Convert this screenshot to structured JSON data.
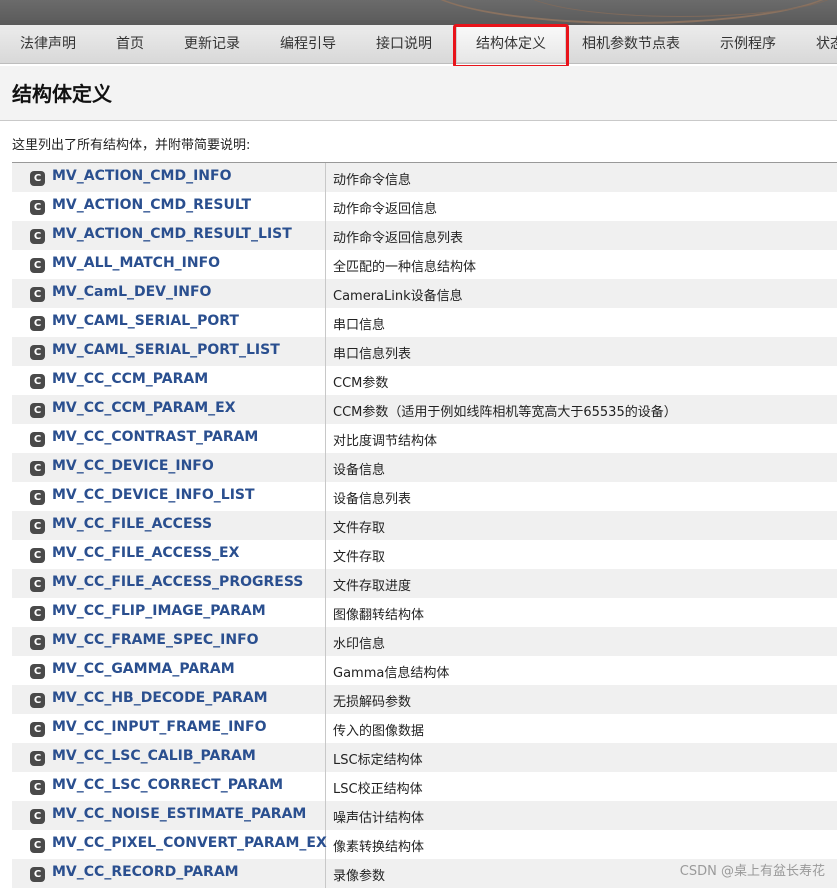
{
  "nav": {
    "tabs": [
      {
        "label": "法律声明",
        "active": false
      },
      {
        "label": "首页",
        "active": false
      },
      {
        "label": "更新记录",
        "active": false
      },
      {
        "label": "编程引导",
        "active": false
      },
      {
        "label": "接口说明",
        "active": false
      },
      {
        "label": "结构体定义",
        "active": true
      },
      {
        "label": "相机参数节点表",
        "active": false
      },
      {
        "label": "示例程序",
        "active": false
      },
      {
        "label": "状态",
        "active": false
      }
    ]
  },
  "page": {
    "title": "结构体定义",
    "intro": "这里列出了所有结构体，并附带简要说明:"
  },
  "structs": [
    {
      "badge": "C",
      "name": "MV_ACTION_CMD_INFO",
      "desc": "动作命令信息"
    },
    {
      "badge": "C",
      "name": "MV_ACTION_CMD_RESULT",
      "desc": "动作命令返回信息"
    },
    {
      "badge": "C",
      "name": "MV_ACTION_CMD_RESULT_LIST",
      "desc": "动作命令返回信息列表"
    },
    {
      "badge": "C",
      "name": "MV_ALL_MATCH_INFO",
      "desc": "全匹配的一种信息结构体"
    },
    {
      "badge": "C",
      "name": "MV_CamL_DEV_INFO",
      "desc": "CameraLink设备信息"
    },
    {
      "badge": "C",
      "name": "MV_CAML_SERIAL_PORT",
      "desc": "串口信息"
    },
    {
      "badge": "C",
      "name": "MV_CAML_SERIAL_PORT_LIST",
      "desc": "串口信息列表"
    },
    {
      "badge": "C",
      "name": "MV_CC_CCM_PARAM",
      "desc": "CCM参数"
    },
    {
      "badge": "C",
      "name": "MV_CC_CCM_PARAM_EX",
      "desc": "CCM参数（适用于例如线阵相机等宽高大于65535的设备）"
    },
    {
      "badge": "C",
      "name": "MV_CC_CONTRAST_PARAM",
      "desc": "对比度调节结构体"
    },
    {
      "badge": "C",
      "name": "MV_CC_DEVICE_INFO",
      "desc": "设备信息"
    },
    {
      "badge": "C",
      "name": "MV_CC_DEVICE_INFO_LIST",
      "desc": "设备信息列表"
    },
    {
      "badge": "C",
      "name": "MV_CC_FILE_ACCESS",
      "desc": "文件存取"
    },
    {
      "badge": "C",
      "name": "MV_CC_FILE_ACCESS_EX",
      "desc": "文件存取"
    },
    {
      "badge": "C",
      "name": "MV_CC_FILE_ACCESS_PROGRESS",
      "desc": "文件存取进度"
    },
    {
      "badge": "C",
      "name": "MV_CC_FLIP_IMAGE_PARAM",
      "desc": "图像翻转结构体"
    },
    {
      "badge": "C",
      "name": "MV_CC_FRAME_SPEC_INFO",
      "desc": "水印信息"
    },
    {
      "badge": "C",
      "name": "MV_CC_GAMMA_PARAM",
      "desc": "Gamma信息结构体"
    },
    {
      "badge": "C",
      "name": "MV_CC_HB_DECODE_PARAM",
      "desc": "无损解码参数"
    },
    {
      "badge": "C",
      "name": "MV_CC_INPUT_FRAME_INFO",
      "desc": "传入的图像数据"
    },
    {
      "badge": "C",
      "name": "MV_CC_LSC_CALIB_PARAM",
      "desc": "LSC标定结构体"
    },
    {
      "badge": "C",
      "name": "MV_CC_LSC_CORRECT_PARAM",
      "desc": "LSC校正结构体"
    },
    {
      "badge": "C",
      "name": "MV_CC_NOISE_ESTIMATE_PARAM",
      "desc": "噪声估计结构体"
    },
    {
      "badge": "C",
      "name": "MV_CC_PIXEL_CONVERT_PARAM_EX",
      "desc": "像素转换结构体"
    },
    {
      "badge": "C",
      "name": "MV_CC_RECORD_PARAM",
      "desc": "录像参数"
    }
  ],
  "watermark": "CSDN @桌上有盆长寿花",
  "colors": {
    "link": "#2a4f8f",
    "highlight": "#e8131a",
    "row_alt": "#f0f0f0",
    "badge": "#4a4a4a"
  }
}
